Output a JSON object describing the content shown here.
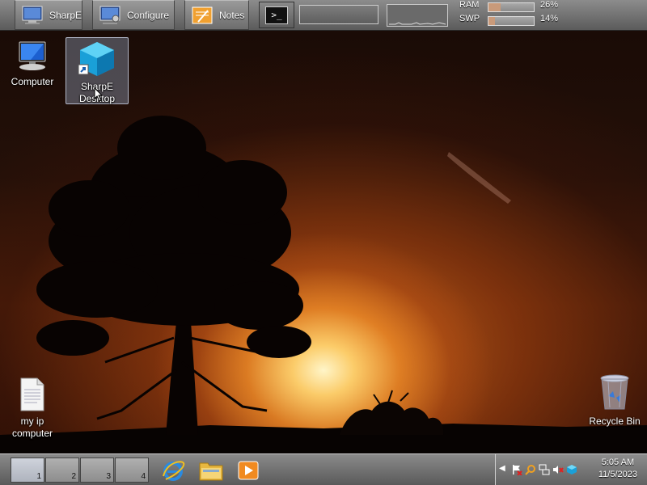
{
  "topbar": {
    "buttons": [
      {
        "label": "SharpE",
        "icon": "monitor-icon"
      },
      {
        "label": "Configure",
        "icon": "monitor-config-icon"
      },
      {
        "label": "Notes",
        "icon": "notes-icon"
      }
    ],
    "terminal": {
      "glyph": ">_",
      "icon": "terminal-icon"
    },
    "meters": {
      "ram": {
        "label": "RAM",
        "percent": "26%",
        "value": 0.26
      },
      "swap": {
        "label": "SWP",
        "percent": "14%",
        "value": 0.14
      }
    }
  },
  "desktop": {
    "icons": [
      {
        "label": "Computer",
        "icon": "computer-icon"
      },
      {
        "label": "SharpE Desktop",
        "icon": "sharpe-cube-icon",
        "selected": true
      },
      {
        "label": "my ip computer",
        "icon": "text-file-icon"
      },
      {
        "label": "Recycle Bin",
        "icon": "recycle-bin-icon"
      }
    ]
  },
  "bottombar": {
    "workspaces": [
      {
        "number": "1"
      },
      {
        "number": "2"
      },
      {
        "number": "3"
      },
      {
        "number": "4"
      }
    ],
    "launchers": [
      {
        "icon": "internet-explorer-icon"
      },
      {
        "icon": "folder-icon"
      },
      {
        "icon": "media-player-icon"
      }
    ],
    "tray": {
      "icons": [
        "flag-icon",
        "search-icon",
        "network-icon",
        "volume-muted-icon",
        "sharpe-tray-icon"
      ]
    },
    "clock": {
      "time": "5:05 AM",
      "date": "11/5/2023"
    }
  },
  "colors": {
    "bar_gray": "#6d6d6d",
    "sun": "#fff0c0",
    "sky_orange": "#c8641c"
  }
}
